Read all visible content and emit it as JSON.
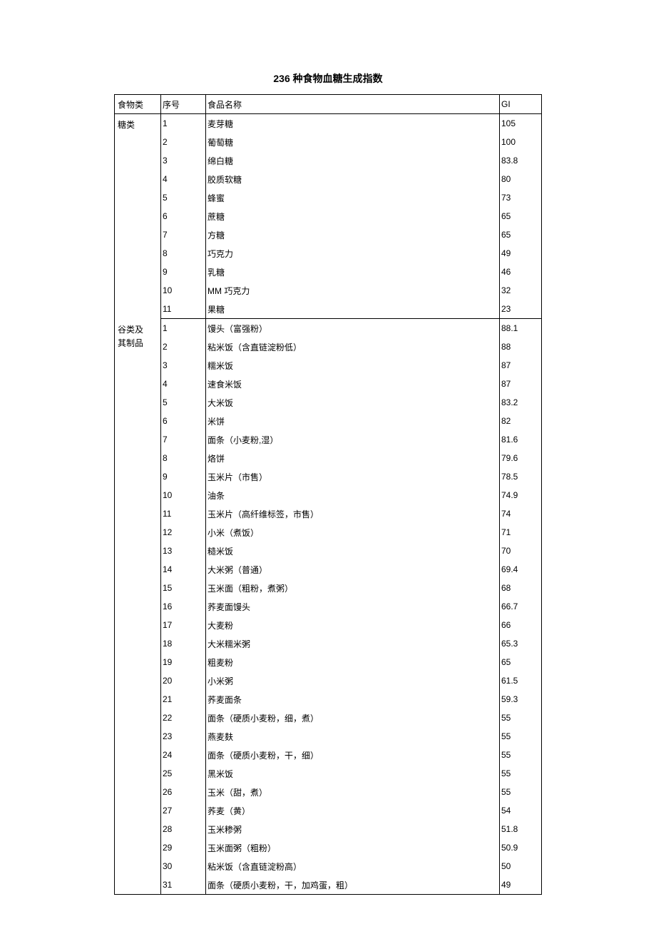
{
  "title": "236 种食物血糖生成指数",
  "headers": {
    "category": "食物类",
    "no": "序号",
    "name": "食品名称",
    "gi": "GI"
  },
  "sections": [
    {
      "category_lines": [
        "糖类"
      ],
      "rows": [
        {
          "no": "1",
          "name": "麦芽糖",
          "gi": "105"
        },
        {
          "no": "2",
          "name": "葡萄糖",
          "gi": "100"
        },
        {
          "no": "3",
          "name": "绵白糖",
          "gi": "83.8"
        },
        {
          "no": "4",
          "name": "胶质软糖",
          "gi": "80"
        },
        {
          "no": "5",
          "name": "蜂蜜",
          "gi": "73"
        },
        {
          "no": "6",
          "name": "蔗糖",
          "gi": "65"
        },
        {
          "no": "7",
          "name": "方糖",
          "gi": "65"
        },
        {
          "no": "8",
          "name": "巧克力",
          "gi": "49"
        },
        {
          "no": "9",
          "name": "乳糖",
          "gi": "46"
        },
        {
          "no": "10",
          "name": "MM 巧克力",
          "gi": "32"
        },
        {
          "no": "11",
          "name": "果糖",
          "gi": "23"
        }
      ]
    },
    {
      "category_lines": [
        "谷类及",
        "其制品"
      ],
      "rows": [
        {
          "no": "1",
          "name": "馒头（富强粉）",
          "gi": "88.1"
        },
        {
          "no": "2",
          "name": "粘米饭（含直链淀粉低）",
          "gi": "88"
        },
        {
          "no": "3",
          "name": "糯米饭",
          "gi": "87"
        },
        {
          "no": "4",
          "name": "速食米饭",
          "gi": "87"
        },
        {
          "no": "5",
          "name": "大米饭",
          "gi": "83.2"
        },
        {
          "no": "6",
          "name": "米饼",
          "gi": "82"
        },
        {
          "no": "7",
          "name": "面条（小麦粉,湿）",
          "gi": "81.6"
        },
        {
          "no": "8",
          "name": "烙饼",
          "gi": "79.6"
        },
        {
          "no": "9",
          "name": "玉米片（市售）",
          "gi": "78.5"
        },
        {
          "no": "10",
          "name": "油条",
          "gi": "74.9"
        },
        {
          "no": "11",
          "name": "玉米片（高纤维标签，市售）",
          "gi": "74"
        },
        {
          "no": "12",
          "name": "小米（煮饭）",
          "gi": "71"
        },
        {
          "no": "13",
          "name": "糙米饭",
          "gi": "70"
        },
        {
          "no": "14",
          "name": "大米粥（普通）",
          "gi": "69.4"
        },
        {
          "no": "15",
          "name": "玉米面（粗粉，煮粥）",
          "gi": "68"
        },
        {
          "no": "16",
          "name": "荞麦面馒头",
          "gi": "66.7"
        },
        {
          "no": "17",
          "name": "大麦粉",
          "gi": "66"
        },
        {
          "no": "18",
          "name": "大米糯米粥",
          "gi": "65.3"
        },
        {
          "no": "19",
          "name": "粗麦粉",
          "gi": "65"
        },
        {
          "no": "20",
          "name": "小米粥",
          "gi": "61.5"
        },
        {
          "no": "21",
          "name": "荞麦面条",
          "gi": "59.3"
        },
        {
          "no": "22",
          "name": "面条（硬质小麦粉，细，煮）",
          "gi": "55"
        },
        {
          "no": "23",
          "name": "燕麦麸",
          "gi": "55"
        },
        {
          "no": "24",
          "name": "面条（硬质小麦粉，干，细）",
          "gi": "55"
        },
        {
          "no": "25",
          "name": "黑米饭",
          "gi": "55"
        },
        {
          "no": "26",
          "name": "玉米（甜，煮）",
          "gi": "55"
        },
        {
          "no": "27",
          "name": "荞麦（黄）",
          "gi": "54"
        },
        {
          "no": "28",
          "name": "玉米糁粥",
          "gi": "51.8"
        },
        {
          "no": "29",
          "name": "玉米面粥（粗粉）",
          "gi": "50.9"
        },
        {
          "no": "30",
          "name": "粘米饭（含直链淀粉高）",
          "gi": "50"
        },
        {
          "no": "31",
          "name": "面条（硬质小麦粉，干，加鸡蛋，粗）",
          "gi": "49"
        }
      ]
    }
  ]
}
